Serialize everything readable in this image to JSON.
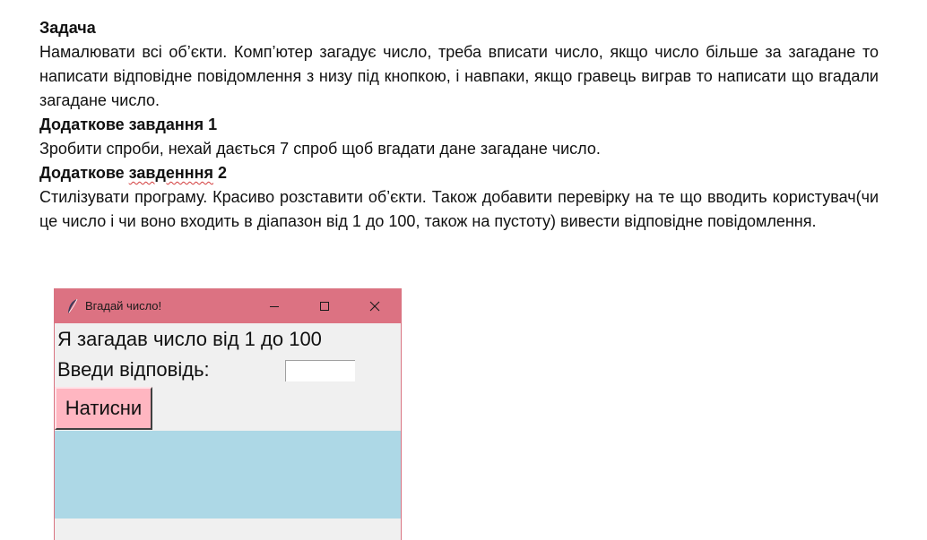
{
  "document": {
    "task_heading": "Задача",
    "task_text": "Намалювати всі об’єкти. Комп’ютер загадує число, треба вписати число, якщо число більше за загадане то написати відповідне повідомлення з низу під кнопкою, і навпаки, якщо гравець виграв то написати що вгадали загадане число.",
    "extra1_heading": "Додаткове завдання 1",
    "extra1_text": "Зробити спроби, нехай дається 7 спроб щоб вгадати дане загадане число.",
    "extra2_heading_prefix": "Додаткове ",
    "extra2_heading_misspelled": "завденння",
    "extra2_heading_suffix": " 2",
    "extra2_text": "Стилізувати програму. Красиво розставити об’єкти. Також добавити перевірку на те що вводить користувач(чи це число і чи воно входить в діапазон від 1 до 100, також на пустоту) вивести відповідне повідомлення."
  },
  "window": {
    "title": "Вгадай число!",
    "titlebar_color": "#dc7282",
    "app_icon": "feather-icon",
    "controls": [
      "minimize-icon",
      "maximize-icon",
      "close-icon"
    ],
    "prompt_label": "Я загадав число від 1 до 100",
    "answer_label": "Введи відповідь:",
    "answer_value": "",
    "button_label": "Натисни",
    "button_color": "#ffb6c1",
    "output_text": "",
    "output_color": "#add8e6"
  }
}
